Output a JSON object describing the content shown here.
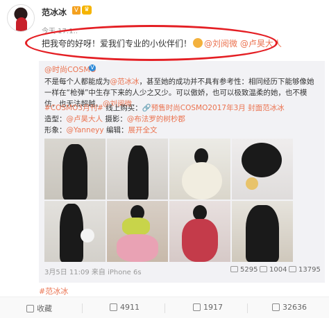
{
  "post": {
    "username": "范冰冰",
    "timestamp": "今天 17:1..",
    "text_before": "把我夸的好呀！爱我们专业的小伙伴们！",
    "mention1": "@刘阅微",
    "mention2": "@卢昊大人"
  },
  "repost": {
    "author": "@时尚COSMO",
    "line1_a": "不是每个人都能成为",
    "line1_mention": "@范冰冰",
    "line1_b": "，甚至她的成功并不具有参考性：相同经历下能够像她一样在“枪",
    "line2": "弹”中生存下来的人少之又少。可以傲娇，也可以极致温柔的她，也不模仿，也无法超越。",
    "line2_mention": "@刘阅微",
    "tag1": "#COSMO3月刊#",
    "tags_mid": " 线上购买：",
    "tag2": "预售时尚COSMO2017年3月 封面范冰冰",
    "line3_a": "造型：",
    "line3_m1": "@卢昊大人",
    "line3_b": "  摄影：",
    "line3_m2": "@布法罗的树杪郡",
    "line4_a": "形象：",
    "line4_m": "@Yanneyy",
    "line4_b": "  编辑：",
    "line4_expand": "展开全文",
    "footer_time": "3月5日 11:09 来自 iPhone 6s",
    "reposts": "5295",
    "comments": "1004",
    "likes": "13795"
  },
  "bottom_tag": "#范冰冰",
  "actions": {
    "favorite": "收藏",
    "repost": "4911",
    "comment": "1917",
    "like": "32636"
  },
  "colors": {
    "accent": "#eb7350",
    "annotation_red": "#e41f24"
  }
}
